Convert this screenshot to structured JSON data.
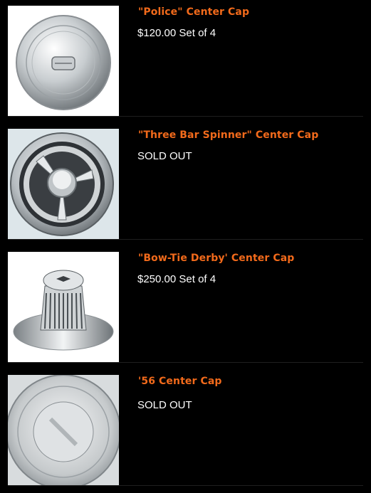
{
  "products": [
    {
      "title": "\"Police\" Center Cap",
      "price": "$120.00 Set of 4",
      "image_icon": "police-center-cap-photo"
    },
    {
      "title": "\"Three Bar Spinner\" Center Cap",
      "price": "SOLD OUT",
      "image_icon": "three-bar-spinner-cap-photo"
    },
    {
      "title": "\"Bow-Tie Derby' Center Cap",
      "price": "$250.00 Set of 4",
      "image_icon": "bow-tie-derby-cap-photo"
    },
    {
      "title": "'56 Center Cap",
      "price": "SOLD OUT",
      "image_icon": "56-center-cap-photo"
    }
  ],
  "colors": {
    "background": "#000000",
    "title": "#f26a1b",
    "price": "#ffffff",
    "divider": "#1f1f1f"
  }
}
